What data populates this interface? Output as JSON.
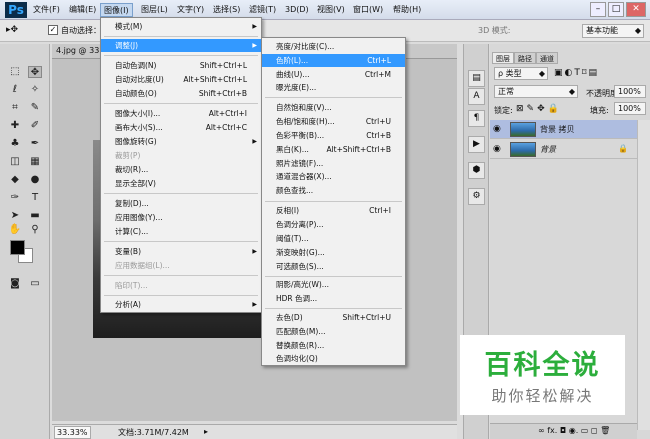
{
  "app": {
    "logo": "Ps"
  },
  "menubar": {
    "items": [
      "文件(F)",
      "编辑(E)",
      "图像(I)",
      "图层(L)",
      "文字(Y)",
      "选择(S)",
      "滤镜(T)",
      "3D(D)",
      "视图(V)",
      "窗口(W)",
      "帮助(H)"
    ],
    "active_index": 2
  },
  "options_bar": {
    "auto_select_label": "自动选择：",
    "mode_3d_label": "3D 模式:",
    "workspace": "基本功能"
  },
  "document": {
    "tab_label": "4.jpg @ 33.3",
    "zoom": "33.33%",
    "doc_info": "文档:3.71M/7.42M"
  },
  "image_menu": {
    "items": [
      {
        "label": "模式(M)",
        "shortcut": "",
        "submenu": true,
        "disabled": false
      },
      {
        "label": "调整(J)",
        "shortcut": "",
        "submenu": true,
        "disabled": false,
        "highlighted": true
      },
      {
        "label": "自动色调(N)",
        "shortcut": "Shift+Ctrl+L",
        "submenu": false,
        "disabled": false
      },
      {
        "label": "自动对比度(U)",
        "shortcut": "Alt+Shift+Ctrl+L",
        "submenu": false,
        "disabled": false
      },
      {
        "label": "自动颜色(O)",
        "shortcut": "Shift+Ctrl+B",
        "submenu": false,
        "disabled": false
      },
      {
        "label": "图像大小(I)...",
        "shortcut": "Alt+Ctrl+I",
        "submenu": false,
        "disabled": false
      },
      {
        "label": "画布大小(S)...",
        "shortcut": "Alt+Ctrl+C",
        "submenu": false,
        "disabled": false
      },
      {
        "label": "图像旋转(G)",
        "shortcut": "",
        "submenu": true,
        "disabled": false
      },
      {
        "label": "裁剪(P)",
        "shortcut": "",
        "submenu": false,
        "disabled": true
      },
      {
        "label": "裁切(R)...",
        "shortcut": "",
        "submenu": false,
        "disabled": false
      },
      {
        "label": "显示全部(V)",
        "shortcut": "",
        "submenu": false,
        "disabled": false
      },
      {
        "label": "复制(D)...",
        "shortcut": "",
        "submenu": false,
        "disabled": false
      },
      {
        "label": "应用图像(Y)...",
        "shortcut": "",
        "submenu": false,
        "disabled": false
      },
      {
        "label": "计算(C)...",
        "shortcut": "",
        "submenu": false,
        "disabled": false
      },
      {
        "label": "变量(B)",
        "shortcut": "",
        "submenu": true,
        "disabled": false
      },
      {
        "label": "应用数据组(L)...",
        "shortcut": "",
        "submenu": false,
        "disabled": true
      },
      {
        "label": "陷印(T)...",
        "shortcut": "",
        "submenu": false,
        "disabled": true
      },
      {
        "label": "分析(A)",
        "shortcut": "",
        "submenu": true,
        "disabled": false
      }
    ]
  },
  "adjust_menu": {
    "items": [
      {
        "label": "亮度/对比度(C)...",
        "shortcut": ""
      },
      {
        "label": "色阶(L)...",
        "shortcut": "Ctrl+L",
        "highlighted": true
      },
      {
        "label": "曲线(U)...",
        "shortcut": "Ctrl+M"
      },
      {
        "label": "曝光度(E)...",
        "shortcut": ""
      },
      {
        "label": "自然饱和度(V)...",
        "shortcut": ""
      },
      {
        "label": "色相/饱和度(H)...",
        "shortcut": "Ctrl+U"
      },
      {
        "label": "色彩平衡(B)...",
        "shortcut": "Ctrl+B"
      },
      {
        "label": "黑白(K)...",
        "shortcut": "Alt+Shift+Ctrl+B"
      },
      {
        "label": "照片滤镜(F)...",
        "shortcut": ""
      },
      {
        "label": "通道混合器(X)...",
        "shortcut": ""
      },
      {
        "label": "颜色查找...",
        "shortcut": ""
      },
      {
        "label": "反相(I)",
        "shortcut": "Ctrl+I"
      },
      {
        "label": "色调分离(P)...",
        "shortcut": ""
      },
      {
        "label": "阈值(T)...",
        "shortcut": ""
      },
      {
        "label": "渐变映射(G)...",
        "shortcut": ""
      },
      {
        "label": "可选颜色(S)...",
        "shortcut": ""
      },
      {
        "label": "阴影/高光(W)...",
        "shortcut": ""
      },
      {
        "label": "HDR 色调...",
        "shortcut": ""
      },
      {
        "label": "去色(D)",
        "shortcut": "Shift+Ctrl+U"
      },
      {
        "label": "匹配颜色(M)...",
        "shortcut": ""
      },
      {
        "label": "替换颜色(R)...",
        "shortcut": ""
      },
      {
        "label": "色调均化(Q)",
        "shortcut": ""
      }
    ]
  },
  "layers_panel": {
    "tabs": [
      "图层",
      "路径",
      "通道"
    ],
    "kind_filter": "ρ 类型",
    "blend_mode": "正常",
    "opacity_label": "不透明度:",
    "opacity_value": "100%",
    "lock_label": "锁定:",
    "fill_label": "填充:",
    "fill_value": "100%",
    "layers": [
      {
        "name": "背景 拷贝",
        "selected": true
      },
      {
        "name": "背景",
        "selected": false
      }
    ],
    "bottom_icons": "∞  fx.  ◘  ◉.  ▭  ◻  🗑"
  },
  "watermark": {
    "title": "百科全说",
    "subtitle": "助你轻松解决"
  },
  "colors": {
    "highlight": "#3399ff",
    "watermark_green": "#2cae3c",
    "layer_selected": "#aebde0"
  }
}
